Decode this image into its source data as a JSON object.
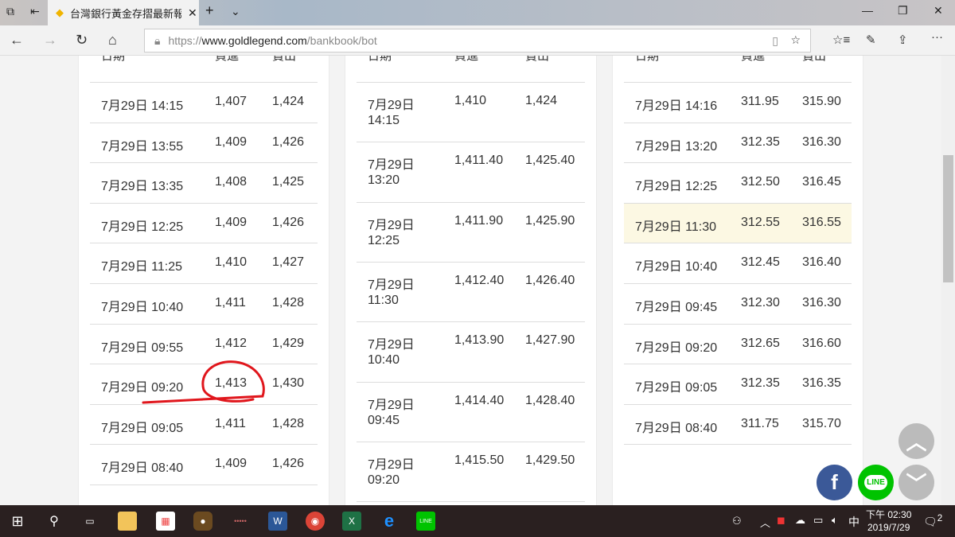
{
  "browser": {
    "tab_title": "台灣銀行黃金存摺最新報",
    "url_scheme": "https://",
    "url_host": "www.goldlegend.com",
    "url_path": "/bankbook/bot"
  },
  "headers": [
    "日期",
    "買進",
    "賣出"
  ],
  "table1": [
    [
      "7月29日 14:15",
      "1,407",
      "1,424"
    ],
    [
      "7月29日 13:55",
      "1,409",
      "1,426"
    ],
    [
      "7月29日 13:35",
      "1,408",
      "1,425"
    ],
    [
      "7月29日 12:25",
      "1,409",
      "1,426"
    ],
    [
      "7月29日 11:25",
      "1,410",
      "1,427"
    ],
    [
      "7月29日 10:40",
      "1,411",
      "1,428"
    ],
    [
      "7月29日 09:55",
      "1,412",
      "1,429"
    ],
    [
      "7月29日 09:20",
      "1,413",
      "1,430"
    ],
    [
      "7月29日 09:05",
      "1,411",
      "1,428"
    ],
    [
      "7月29日 08:40",
      "1,409",
      "1,426"
    ]
  ],
  "table2": [
    [
      "7月29日",
      "14:15",
      "1,410",
      "1,424"
    ],
    [
      "7月29日",
      "13:20",
      "1,411.40",
      "1,425.40"
    ],
    [
      "7月29日",
      "12:25",
      "1,411.90",
      "1,425.90"
    ],
    [
      "7月29日",
      "11:30",
      "1,412.40",
      "1,426.40"
    ],
    [
      "7月29日",
      "10:40",
      "1,413.90",
      "1,427.90"
    ],
    [
      "7月29日",
      "09:45",
      "1,414.40",
      "1,428.40"
    ],
    [
      "7月29日",
      "09:20",
      "1,415.50",
      "1,429.50"
    ]
  ],
  "table3": [
    [
      "7月29日 14:16",
      "311.95",
      "315.90"
    ],
    [
      "7月29日 13:20",
      "312.35",
      "316.30"
    ],
    [
      "7月29日 12:25",
      "312.50",
      "316.45"
    ],
    [
      "7月29日 11:30",
      "312.55",
      "316.55"
    ],
    [
      "7月29日 10:40",
      "312.45",
      "316.40"
    ],
    [
      "7月29日 09:45",
      "312.30",
      "316.30"
    ],
    [
      "7月29日 09:20",
      "312.65",
      "316.60"
    ],
    [
      "7月29日 09:05",
      "312.35",
      "316.35"
    ],
    [
      "7月29日 08:40",
      "311.75",
      "315.70"
    ]
  ],
  "table3_highlight_index": 3,
  "fab": {
    "facebook": "f",
    "line": "LINE"
  },
  "clock": {
    "time": "下午 02:30",
    "date": "2019/7/29"
  },
  "ime": "中",
  "notifications": "2",
  "colors": {
    "annotation": "#e0161c",
    "highlight": "#fcf8e3",
    "facebook": "#3b5998",
    "line": "#00c300"
  }
}
